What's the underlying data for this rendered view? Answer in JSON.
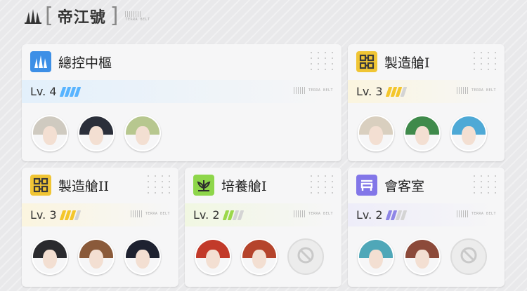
{
  "header": {
    "title": "帝江號",
    "icon": "base-logo-icon",
    "deco_text": "TERRA BELT"
  },
  "rooms": [
    {
      "name": "總控中樞",
      "icon": "control-center-icon",
      "icon_color": "#3d8fe6",
      "level_label": "Lv. 4",
      "level": 4,
      "bar_color": "#58b4ff",
      "band_color": "#e3f0fb",
      "operators": [
        {
          "name": "operator-1",
          "hair": "#cfcac0"
        },
        {
          "name": "operator-2",
          "hair": "#2b2f3a"
        },
        {
          "name": "operator-3",
          "hair": "#b7c78f"
        }
      ]
    },
    {
      "name": "製造艙I",
      "icon": "manufacture-icon",
      "icon_color": "#f0c534",
      "level_label": "Lv. 3",
      "level": 3,
      "bar_color": "#f4c62b",
      "band_color": "#fbf5df",
      "operators": [
        {
          "name": "operator-4",
          "hair": "#d9cfbf"
        },
        {
          "name": "operator-5",
          "hair": "#3f8a4b"
        },
        {
          "name": "operator-6",
          "hair": "#4ea9d6"
        }
      ]
    },
    {
      "name": "製造艙II",
      "icon": "manufacture-icon",
      "icon_color": "#f0c534",
      "level_label": "Lv. 3",
      "level": 3,
      "bar_color": "#f4c62b",
      "band_color": "#fbf5df",
      "operators": [
        {
          "name": "operator-7",
          "hair": "#2a2a2e"
        },
        {
          "name": "operator-8",
          "hair": "#8a5a3a"
        },
        {
          "name": "operator-9",
          "hair": "#1e2230"
        }
      ]
    },
    {
      "name": "培養艙I",
      "icon": "growth-chamber-icon",
      "icon_color": "#8ed64a",
      "level_label": "Lv. 2",
      "level": 2,
      "bar_color": "#9bd84a",
      "band_color": "#f1f7e2",
      "operators": [
        {
          "name": "operator-10",
          "hair": "#c23a2a"
        },
        {
          "name": "operator-11",
          "hair": "#b5442c"
        },
        {
          "name": "empty-slot",
          "hair": null
        }
      ]
    },
    {
      "name": "會客室",
      "icon": "reception-room-icon",
      "icon_color": "#8276e8",
      "level_label": "Lv. 2",
      "level": 2,
      "bar_color": "#8f86e6",
      "band_color": "#eeedf9",
      "operators": [
        {
          "name": "operator-12",
          "hair": "#4fa7b8"
        },
        {
          "name": "operator-13",
          "hair": "#8c4a3a"
        },
        {
          "name": "empty-slot",
          "hair": null
        }
      ]
    }
  ]
}
